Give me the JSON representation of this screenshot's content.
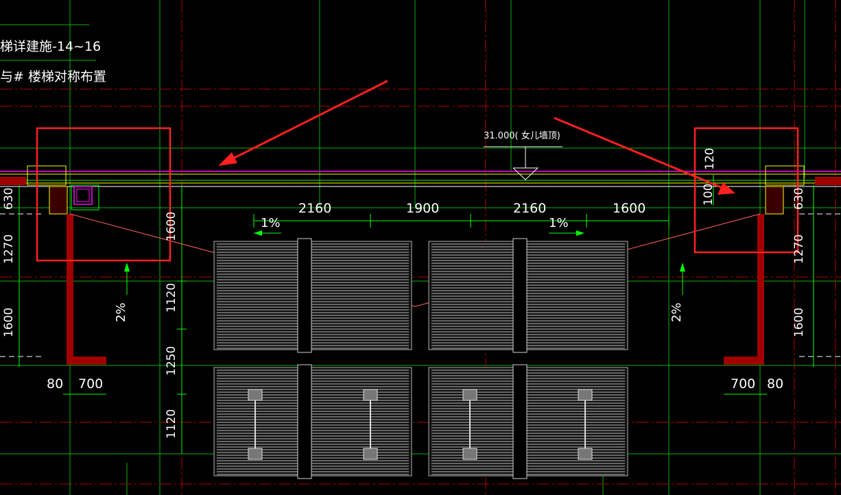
{
  "drawing": {
    "notes": {
      "line1": "梯详建施-14~16",
      "line2": "与# 楼梯对称布置"
    },
    "elevation_label": "31.000(   女儿墙顶)",
    "dimensions": {
      "top": [
        "2160",
        "1900",
        "2160",
        "1600"
      ],
      "left_vertical": [
        "630",
        "1270",
        "1600"
      ],
      "right_vertical": [
        "630",
        "1270",
        "1600"
      ],
      "inner_vertical": [
        "1600",
        "1120",
        "1250",
        "1120"
      ],
      "right_small": [
        "120",
        "100"
      ],
      "bottom_left": [
        "80",
        "700"
      ],
      "bottom_right": [
        "700",
        "80"
      ]
    },
    "slopes": {
      "top_left": "1%",
      "top_right": "1%",
      "left_side": "2%",
      "right_side": "2%"
    },
    "colors": {
      "background": "#000000",
      "grid_green": "#00c000",
      "axis_red": "#c00000",
      "magenta": "#ff00ff",
      "highlight_red": "#ff2020",
      "column_dark_red": "#a00000",
      "equipment_gray": "#a0a0a0",
      "text_white": "#ffffff"
    }
  }
}
